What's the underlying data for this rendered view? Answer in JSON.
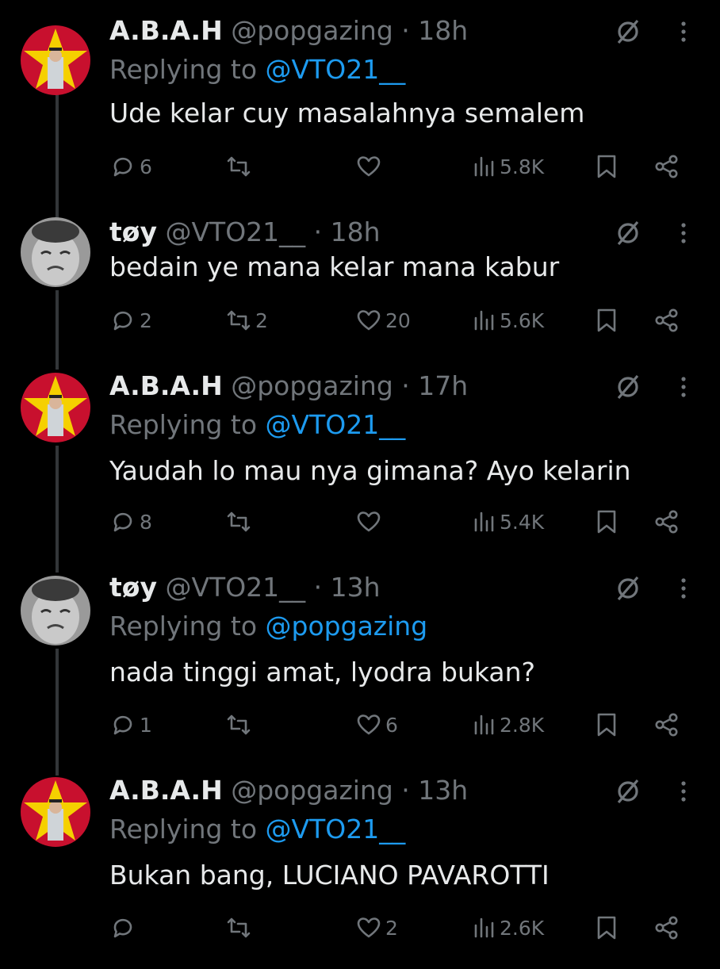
{
  "tweets": [
    {
      "name": "A.B.A.H",
      "handle": "@popgazing",
      "dot": "·",
      "time": "18h",
      "replying_prefix": "Replying to",
      "replying_to": "@VTO21__",
      "text": "Ude kelar cuy masalahnya semalem",
      "replies": "6",
      "retweets": "",
      "likes": "",
      "views": "5.8K",
      "avatar": "star-avatar"
    },
    {
      "name": "tøy",
      "handle": "@VTO21__",
      "dot": "·",
      "time": "18h",
      "replying_prefix": "",
      "replying_to": "",
      "text": "bedain ye mana kelar mana kabur",
      "replies": "2",
      "retweets": "2",
      "likes": "20",
      "views": "5.6K",
      "avatar": "face-avatar"
    },
    {
      "name": "A.B.A.H",
      "handle": "@popgazing",
      "dot": "·",
      "time": "17h",
      "replying_prefix": "Replying to",
      "replying_to": "@VTO21__",
      "text": "Yaudah lo mau nya gimana? Ayo kelarin",
      "replies": "8",
      "retweets": "",
      "likes": "",
      "views": "5.4K",
      "avatar": "star-avatar"
    },
    {
      "name": "tøy",
      "handle": "@VTO21__",
      "dot": "·",
      "time": "13h",
      "replying_prefix": "Replying to",
      "replying_to": "@popgazing",
      "text": "nada tinggi amat, lyodra bukan?",
      "replies": "1",
      "retweets": "",
      "likes": "6",
      "views": "2.8K",
      "avatar": "face-avatar"
    },
    {
      "name": "A.B.A.H",
      "handle": "@popgazing",
      "dot": "·",
      "time": "13h",
      "replying_prefix": "Replying to",
      "replying_to": "@VTO21__",
      "text": "Bukan bang, LUCIANO PAVAROTTI",
      "replies": "",
      "retweets": "",
      "likes": "2",
      "views": "2.6K",
      "avatar": "star-avatar"
    }
  ],
  "colors": {
    "background": "#000000",
    "text": "#e7e9ea",
    "muted": "#71767b",
    "accent": "#1d9bf0"
  }
}
